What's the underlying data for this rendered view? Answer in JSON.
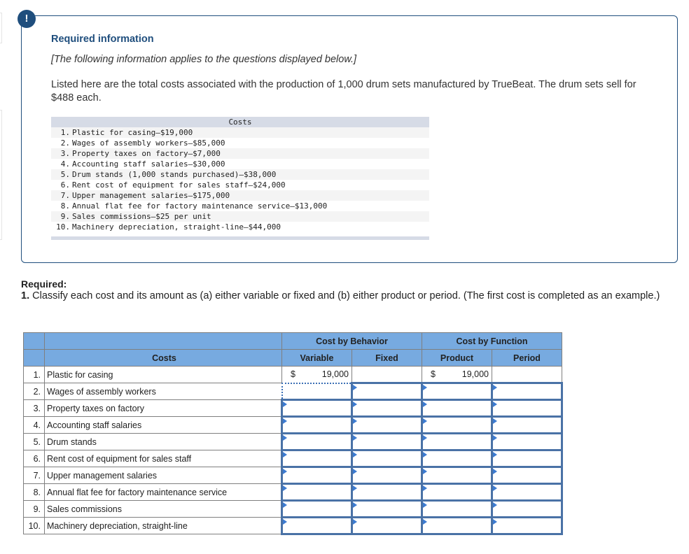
{
  "alert_icon": "!",
  "info": {
    "title": "Required information",
    "note": "[The following information applies to the questions displayed below.]",
    "intro": "Listed here are the total costs associated with the production of 1,000 drum sets manufactured by TrueBeat. The drum sets sell for $488 each."
  },
  "costs_list": {
    "header": "Costs",
    "items": [
      {
        "num": "1.",
        "text": "Plastic for casing—$19,000"
      },
      {
        "num": "2.",
        "text": "Wages of assembly workers—$85,000"
      },
      {
        "num": "3.",
        "text": "Property taxes on factory—$7,000"
      },
      {
        "num": "4.",
        "text": "Accounting staff salaries—$30,000"
      },
      {
        "num": "5.",
        "text": "Drum stands (1,000 stands purchased)—$38,000"
      },
      {
        "num": "6.",
        "text": "Rent cost of equipment for sales staff—$24,000"
      },
      {
        "num": "7.",
        "text": "Upper management salaries—$175,000"
      },
      {
        "num": "8.",
        "text": "Annual flat fee for factory maintenance service—$13,000"
      },
      {
        "num": "9.",
        "text": "Sales commissions—$25 per unit"
      },
      {
        "num": "10.",
        "text": "Machinery depreciation, straight-line—$44,000"
      }
    ]
  },
  "required": {
    "label": "Required:",
    "number": "1.",
    "text": " Classify each cost and its amount as (a) either variable or fixed and (b) either product or period. (The first cost is completed as an example.)"
  },
  "answer_table": {
    "group_headers": {
      "behavior": "Cost by Behavior",
      "function": "Cost by Function"
    },
    "col_headers": {
      "costs": "Costs",
      "variable": "Variable",
      "fixed": "Fixed",
      "product": "Product",
      "period": "Period"
    },
    "rows": [
      {
        "num": "1.",
        "cost": "Plastic for casing",
        "variable": {
          "currency": "$",
          "amount": "19,000"
        },
        "fixed": "",
        "product": {
          "currency": "$",
          "amount": "19,000"
        },
        "period": ""
      },
      {
        "num": "2.",
        "cost": "Wages of assembly workers"
      },
      {
        "num": "3.",
        "cost": "Property taxes on factory"
      },
      {
        "num": "4.",
        "cost": "Accounting staff salaries"
      },
      {
        "num": "5.",
        "cost": "Drum stands"
      },
      {
        "num": "6.",
        "cost": "Rent cost of equipment for sales staff"
      },
      {
        "num": "7.",
        "cost": "Upper management salaries"
      },
      {
        "num": "8.",
        "cost": "Annual flat fee for factory maintenance service"
      },
      {
        "num": "9.",
        "cost": "Sales commissions"
      },
      {
        "num": "10.",
        "cost": "Machinery depreciation, straight-line"
      }
    ]
  }
}
